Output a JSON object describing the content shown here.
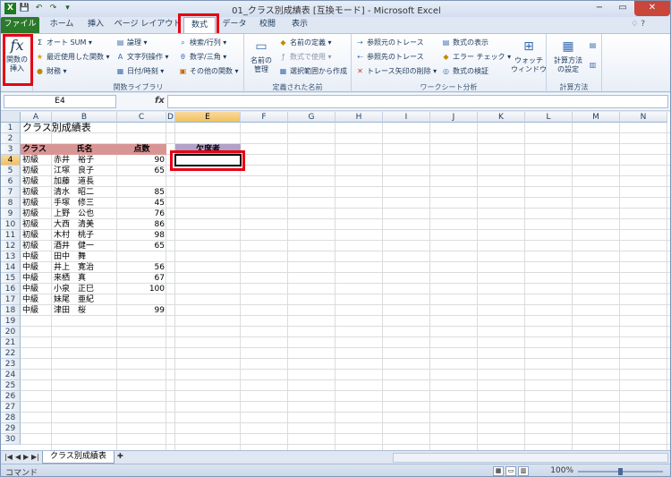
{
  "window": {
    "title": "01_クラス別成績表 [互換モード] - Microsoft Excel",
    "min": "−",
    "max": "▭",
    "close": "✕"
  },
  "quick_access": [
    "X",
    "💾",
    "↶",
    "↷",
    "▾"
  ],
  "tabs": [
    "ファイル",
    "ホーム",
    "挿入",
    "ページ レイアウト",
    "数式",
    "データ",
    "校閲",
    "表示"
  ],
  "active_tab": "数式",
  "ribbon": {
    "insert_function": "関数の\n挿入",
    "library": {
      "autosum": "オート SUM",
      "recent": "最近使用した関数",
      "financial": "財務",
      "logical": "論理",
      "text": "文字列操作",
      "datetime": "日付/時刻",
      "lookup": "検索/行列",
      "math": "数学/三角",
      "more": "その他の関数",
      "label": "関数ライブラリ"
    },
    "names": {
      "manager": "名前の\n管理",
      "define": "名前の定義",
      "use": "数式で使用",
      "create": "選択範囲から作成",
      "label": "定義された名前"
    },
    "audit": {
      "precedents": "参照元のトレース",
      "dependents": "参照先のトレース",
      "remove": "トレース矢印の削除",
      "show": "数式の表示",
      "error": "エラー チェック",
      "evaluate": "数式の検証",
      "watch": "ウォッチ\nウィンドウ",
      "label": "ワークシート分析"
    },
    "calc": {
      "options": "計算方法\nの設定",
      "label": "計算方法"
    }
  },
  "formula_bar": {
    "name_box": "E4",
    "fx": "fx",
    "value": ""
  },
  "columns": [
    "A",
    "B",
    "C",
    "D",
    "E",
    "F",
    "G",
    "H",
    "I",
    "J",
    "K",
    "L",
    "M",
    "N"
  ],
  "selected_column": "E",
  "selected_row": 4,
  "rows": [
    1,
    2,
    3,
    4,
    5,
    6,
    7,
    8,
    9,
    10,
    11,
    12,
    13,
    14,
    15,
    16,
    17,
    18,
    19,
    20,
    21,
    22,
    23,
    24,
    25,
    26,
    27,
    28,
    29,
    30
  ],
  "sheet": {
    "title": "クラス別成績表",
    "headers": {
      "class": "クラス",
      "name": "氏名",
      "score": "点数",
      "absent": "欠席者"
    },
    "data": [
      {
        "class": "初級",
        "name": "赤井　裕子",
        "score": "90"
      },
      {
        "class": "初級",
        "name": "江塚　良子",
        "score": "65"
      },
      {
        "class": "初級",
        "name": "加藤　道長",
        "score": ""
      },
      {
        "class": "初級",
        "name": "清水　昭二",
        "score": "85"
      },
      {
        "class": "初級",
        "name": "手塚　修三",
        "score": "45"
      },
      {
        "class": "初級",
        "name": "上野　公也",
        "score": "76"
      },
      {
        "class": "初級",
        "name": "大西　清美",
        "score": "86"
      },
      {
        "class": "初級",
        "name": "木村　桃子",
        "score": "98"
      },
      {
        "class": "初級",
        "name": "酒井　健一",
        "score": "65"
      },
      {
        "class": "中級",
        "name": "田中　舞",
        "score": ""
      },
      {
        "class": "中級",
        "name": "井上　寛治",
        "score": "56"
      },
      {
        "class": "中級",
        "name": "来栖　真",
        "score": "67"
      },
      {
        "class": "中級",
        "name": "小泉　正巳",
        "score": "100"
      },
      {
        "class": "中級",
        "name": "妹尾　亜紀",
        "score": ""
      },
      {
        "class": "中級",
        "name": "津田　桜",
        "score": "99"
      }
    ]
  },
  "sheet_tab": "クラス別成績表",
  "status": {
    "mode": "コマンド",
    "zoom": "100%"
  },
  "colors": {
    "file_tab": "#2a7a2a",
    "header_fill": "#d99594",
    "absent_fill": "#b2a2c7",
    "highlight": "#e60012",
    "selection": "#f1c15f"
  }
}
